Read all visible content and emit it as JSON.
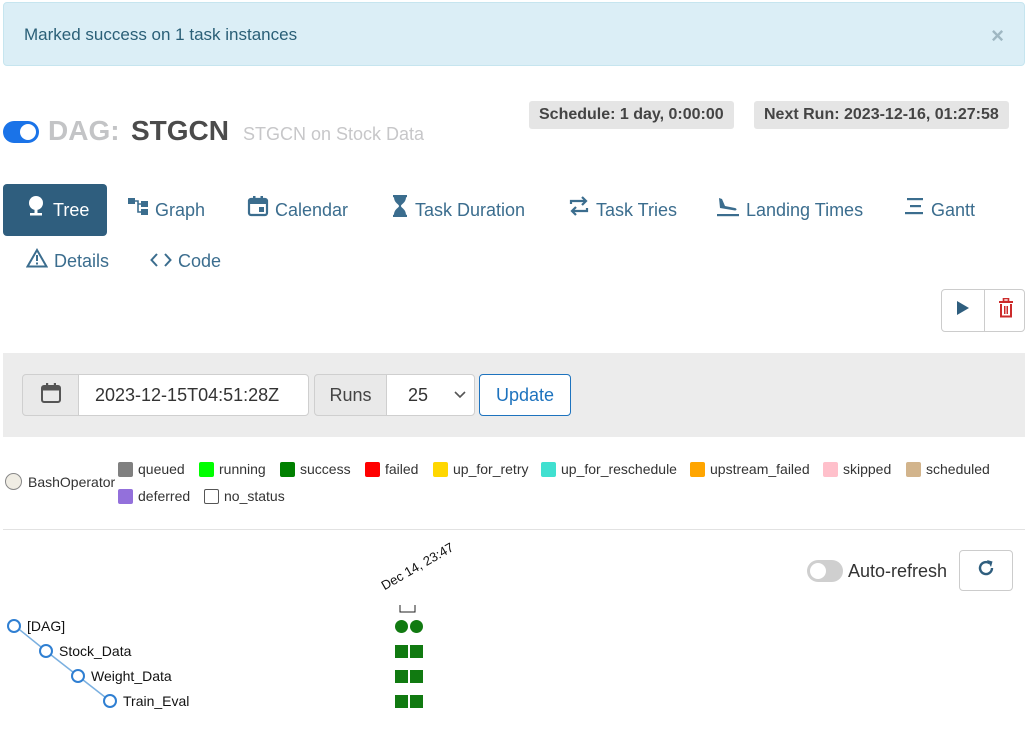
{
  "alert": {
    "message": "Marked success on 1 task instances",
    "close": "×"
  },
  "header": {
    "dag_prefix": "DAG:",
    "dag_id": "STGCN",
    "description": "STGCN on Stock Data",
    "schedule": "Schedule: 1 day, 0:00:00",
    "next_run": "Next Run: 2023-12-16, 01:27:58",
    "paused": false
  },
  "tabs": [
    {
      "label": "Tree",
      "icon": "tree-icon",
      "active": true
    },
    {
      "label": "Graph",
      "icon": "graph-icon"
    },
    {
      "label": "Calendar",
      "icon": "calendar-icon"
    },
    {
      "label": "Task Duration",
      "icon": "hourglass-icon"
    },
    {
      "label": "Task Tries",
      "icon": "retry-icon"
    },
    {
      "label": "Landing Times",
      "icon": "plane-landing-icon"
    },
    {
      "label": "Gantt",
      "icon": "gantt-icon"
    },
    {
      "label": "Details",
      "icon": "warning-triangle-icon"
    },
    {
      "label": "Code",
      "icon": "code-icon"
    }
  ],
  "actions": {
    "trigger_icon": "play-icon",
    "delete_icon": "trash-icon"
  },
  "filters": {
    "date_value": "2023-12-15T04:51:28Z",
    "runs_label": "Runs",
    "runs_value": "25",
    "update_label": "Update"
  },
  "legend": {
    "operator": "BashOperator",
    "states": [
      {
        "label": "queued",
        "color": "#808080"
      },
      {
        "label": "running",
        "color": "#00ff00"
      },
      {
        "label": "success",
        "color": "#008000"
      },
      {
        "label": "failed",
        "color": "#ff0000"
      },
      {
        "label": "up_for_retry",
        "color": "#ffd700"
      },
      {
        "label": "up_for_reschedule",
        "color": "#40e0d0"
      },
      {
        "label": "upstream_failed",
        "color": "#ffa500"
      },
      {
        "label": "skipped",
        "color": "#ffc0cb"
      },
      {
        "label": "scheduled",
        "color": "#d2b48c"
      },
      {
        "label": "deferred",
        "color": "#9370db"
      },
      {
        "label": "no_status",
        "color": "#ffffff"
      }
    ]
  },
  "auto_refresh": {
    "label": "Auto-refresh",
    "enabled": false
  },
  "tree": {
    "run_label": "Dec 14, 23:47",
    "nodes": [
      {
        "label": "[DAG]",
        "states": [
          "success",
          "success"
        ]
      },
      {
        "label": "Stock_Data",
        "states": [
          "success",
          "success"
        ]
      },
      {
        "label": "Weight_Data",
        "states": [
          "success",
          "success"
        ]
      },
      {
        "label": "Train_Eval",
        "states": [
          "success",
          "success"
        ]
      }
    ]
  }
}
